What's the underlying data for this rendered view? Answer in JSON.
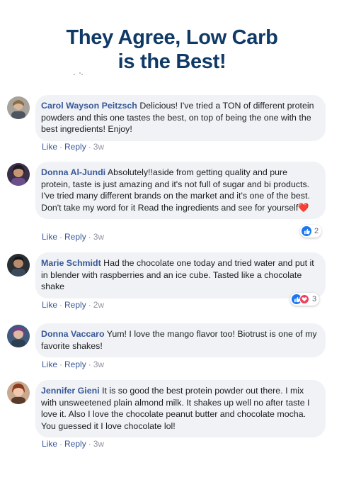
{
  "headline": {
    "line1": "They Agree, Low Carb",
    "line2": "is the Best!"
  },
  "action_labels": {
    "like": "Like",
    "reply": "Reply",
    "separator": "·"
  },
  "comments": [
    {
      "author": "Carol Wayson Peitzsch",
      "text": "Delicious! I've tried a TON of different protein powders and this one tastes the best, on top of being the one with the best ingredients! Enjoy!",
      "time": "3w"
    },
    {
      "author": "Donna Al-Jundi",
      "text": "Absolutely!!aside from getting quality and pure protein, taste is just amazing and it's not full of sugar and bi products. I've tried many different brands on the market and it's one of the best. Don't take my word for it Read the ingredients and see for yourself",
      "emoji": "❤️",
      "time": "3w",
      "reactions": {
        "icons": [
          "like"
        ],
        "count": "2"
      }
    },
    {
      "author": "Marie Schmidt",
      "text": "Had the chocolate one today and tried water and put it in blender with raspberries and an ice cube. Tasted like a chocolate shake",
      "time": "2w",
      "reactions": {
        "icons": [
          "like",
          "love"
        ],
        "count": "3"
      }
    },
    {
      "author": "Donna Vaccaro",
      "text": "Yum! I love the mango flavor too! Biotrust is one of my favorite shakes!",
      "time": "3w"
    },
    {
      "author": "Jennifer Gieni",
      "text": "It is so good the best protein powder out there. I mix with unsweetened plain almond milk. It shakes up well no after taste I love it. Also I love the chocolate peanut butter and chocolate mocha. You guessed it I love chocolate lol!",
      "time": "3w"
    }
  ],
  "colors": {
    "headline": "#0f3a66",
    "name_link": "#385898",
    "bubble_bg": "#f0f2f5",
    "like_blue": "#1877f2",
    "love_red": "#f33e58"
  }
}
